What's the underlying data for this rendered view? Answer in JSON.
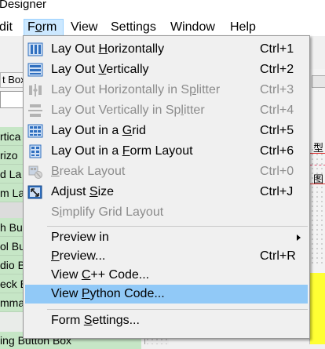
{
  "window": {
    "title_fragment": "Designer"
  },
  "menubar": {
    "items": [
      {
        "label": "dit",
        "active": false
      },
      {
        "label": "Form",
        "mnemonic_index": 1,
        "active": true
      },
      {
        "label": "View",
        "active": false
      },
      {
        "label": "Settings",
        "active": false
      },
      {
        "label": "Window",
        "active": false
      },
      {
        "label": "Help",
        "active": false
      }
    ]
  },
  "widget_box": {
    "filter_fragment": "t Box",
    "rows": [
      "rtica",
      "rizo",
      "d La",
      "m La",
      "h Bu",
      "ol Bu",
      "dio B",
      "eck B",
      "mma"
    ],
    "bottom_item": "ing Button Box"
  },
  "right_panel": {
    "char_1": "型",
    "char_2": "图"
  },
  "form_menu": {
    "items": [
      {
        "pre": "Lay Out ",
        "u": "H",
        "post": "orizontally",
        "shortcut": "Ctrl+1",
        "icon": "layout-horizontal-icon",
        "enabled": true
      },
      {
        "pre": "Lay Out ",
        "u": "V",
        "post": "ertically",
        "shortcut": "Ctrl+2",
        "icon": "layout-vertical-icon",
        "enabled": true
      },
      {
        "pre": "Lay Out Horizontally in S",
        "u": "p",
        "post": "litter",
        "shortcut": "Ctrl+3",
        "icon": "splitter-horizontal-icon",
        "enabled": false
      },
      {
        "pre": "Lay Out Vertically in Sp",
        "u": "l",
        "post": "itter",
        "shortcut": "Ctrl+4",
        "icon": "splitter-vertical-icon",
        "enabled": false
      },
      {
        "pre": "Lay Out in a ",
        "u": "G",
        "post": "rid",
        "shortcut": "Ctrl+5",
        "icon": "layout-grid-icon",
        "enabled": true
      },
      {
        "pre": "Lay Out in a ",
        "u": "F",
        "post": "orm Layout",
        "shortcut": "Ctrl+6",
        "icon": "layout-form-icon",
        "enabled": true
      },
      {
        "pre": "",
        "u": "B",
        "post": "reak Layout",
        "shortcut": "Ctrl+0",
        "icon": "break-layout-icon",
        "enabled": false
      },
      {
        "pre": "Adjust ",
        "u": "S",
        "post": "ize",
        "shortcut": "Ctrl+J",
        "icon": "adjust-size-icon",
        "enabled": true
      },
      {
        "pre": "S",
        "u": "i",
        "post": "mplify Grid Layout",
        "shortcut": "",
        "icon": "",
        "enabled": false
      },
      {
        "pre": "Preview in",
        "u": "",
        "post": "",
        "shortcut": "",
        "icon": "",
        "enabled": true,
        "submenu": true
      },
      {
        "pre": "",
        "u": "P",
        "post": "review...",
        "shortcut": "Ctrl+R",
        "icon": "",
        "enabled": true
      },
      {
        "pre": "View ",
        "u": "C",
        "post": "++ Code...",
        "shortcut": "",
        "icon": "",
        "enabled": true
      },
      {
        "pre": "View ",
        "u": "P",
        "post": "ython Code...",
        "shortcut": "",
        "icon": "",
        "enabled": true,
        "highlighted": true
      },
      {
        "pre": "Form ",
        "u": "S",
        "post": "ettings...",
        "shortcut": "",
        "icon": "",
        "enabled": true
      }
    ]
  },
  "colors": {
    "menu_highlight": "#91c9f7",
    "menubar_active": "#cce8ff",
    "disabled_text": "#8c8c8c",
    "icon_blue": "#2f6fbf",
    "widget_row_green": "#c6e6c6",
    "yellow_widget": "#ffff33"
  }
}
